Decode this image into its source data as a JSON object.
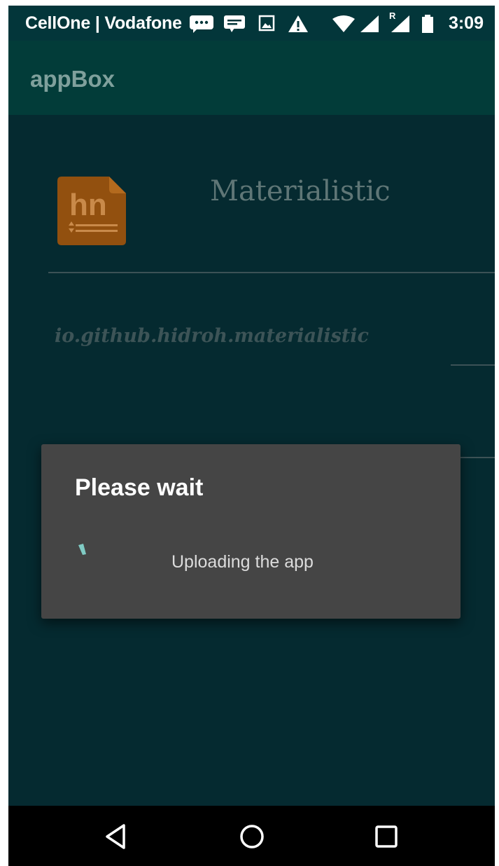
{
  "status_bar": {
    "carrier": "CellOne | Vodafone",
    "time": "3:09",
    "icons": [
      "chat-more-icon",
      "message-icon",
      "image-icon",
      "warning-icon",
      "wifi-icon",
      "signal-icon",
      "roaming-signal-icon",
      "battery-icon"
    ],
    "roaming_label": "R"
  },
  "app_bar": {
    "title": "appBox"
  },
  "app_info": {
    "name": "Materialistic",
    "icon": "hn-app-icon",
    "icon_text": "hn",
    "icon_color": "#c26a12",
    "package": "io.github.hidroh.materialistic"
  },
  "dialog": {
    "title": "Please wait",
    "message": "Uploading the app"
  },
  "nav_bar": {
    "buttons": [
      "back-icon",
      "home-icon",
      "recents-icon"
    ]
  },
  "colors": {
    "status_bar": "#03363a",
    "app_bar": "#023c39",
    "background": "#052a30",
    "dialog": "#454545",
    "accent": "#80cbc4"
  }
}
